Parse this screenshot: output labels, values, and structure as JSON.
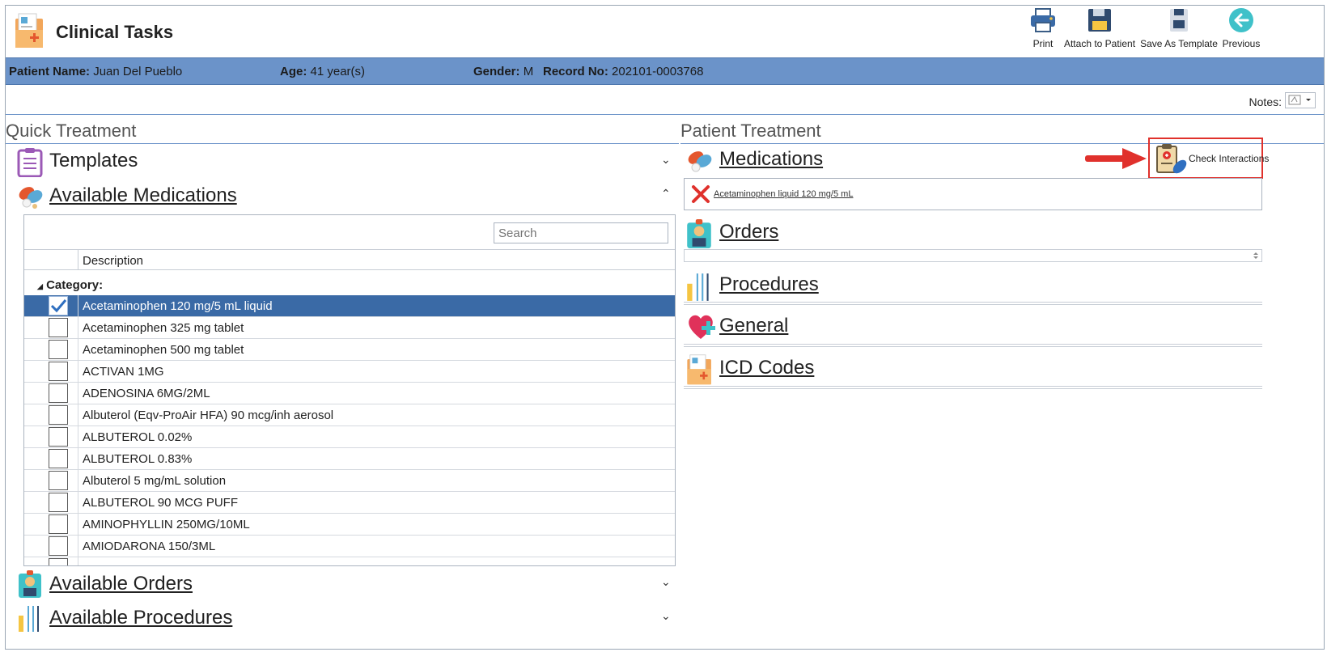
{
  "app": {
    "title": "Clinical Tasks"
  },
  "toolbar": {
    "print": "Print",
    "attach": "Attach to Patient",
    "save_template": "Save As Template",
    "previous": "Previous"
  },
  "patient": {
    "name_label": "Patient Name:",
    "name": "Juan Del Pueblo",
    "age_label": "Age:",
    "age": "41 year(s)",
    "gender_label": "Gender:",
    "gender": "M",
    "record_label": "Record No:",
    "record": "202101-0003768"
  },
  "notes": {
    "label": "Notes:"
  },
  "quick": {
    "title": "Quick Treatment",
    "templates": "Templates",
    "available_medications": "Available Medications",
    "available_orders": "Available Orders",
    "available_procedures": "Available Procedures",
    "search_placeholder": "Search",
    "column_description": "Description",
    "category_label": "Category:",
    "medications": [
      {
        "name": "Acetaminophen 120 mg/5 mL liquid",
        "checked": true
      },
      {
        "name": "Acetaminophen 325 mg tablet",
        "checked": false
      },
      {
        "name": "Acetaminophen 500 mg tablet",
        "checked": false
      },
      {
        "name": "ACTIVAN 1MG",
        "checked": false
      },
      {
        "name": "ADENOSINA 6MG/2ML",
        "checked": false
      },
      {
        "name": "Albuterol (Eqv-ProAir HFA) 90 mcg/inh aerosol",
        "checked": false
      },
      {
        "name": "ALBUTEROL 0.02%",
        "checked": false
      },
      {
        "name": "ALBUTEROL 0.83%",
        "checked": false
      },
      {
        "name": "Albuterol 5 mg/mL solution",
        "checked": false
      },
      {
        "name": "ALBUTEROL 90 MCG PUFF",
        "checked": false
      },
      {
        "name": "AMINOPHYLLIN 250MG/10ML",
        "checked": false
      },
      {
        "name": "AMIODARONA 150/3ML",
        "checked": false
      }
    ]
  },
  "patient_treatment": {
    "title": "Patient Treatment",
    "medications": "Medications",
    "check_interactions": "Check Interactions",
    "selected_medication": "Acetaminophen liquid 120 mg/5 mL",
    "orders": "Orders",
    "procedures": "Procedures",
    "general": "General",
    "icd_codes": "ICD Codes"
  },
  "colors": {
    "patient_bar": "#6b93c9",
    "selected_row": "#3a6aa6",
    "highlight": "#e0312c"
  }
}
